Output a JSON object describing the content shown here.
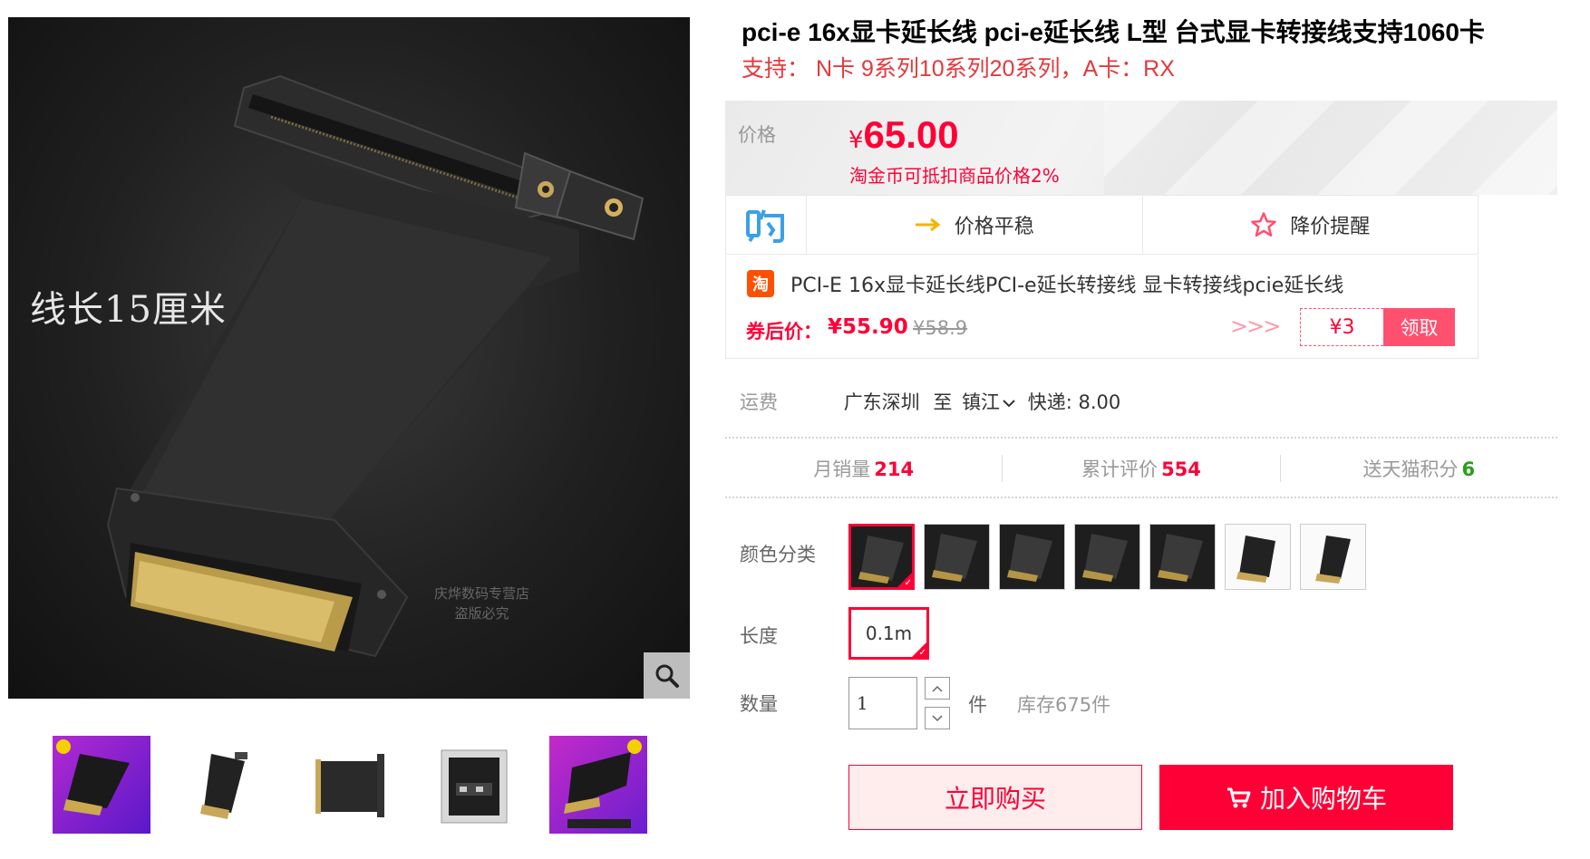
{
  "product": {
    "title": "pci-e 16x显卡延长线 pci-e延长线 L型 台式显卡转接线支持1060卡",
    "subtitle": "支持： N卡 9系列10系列20系列，A卡：RX"
  },
  "gallery": {
    "main_caption": "线长15厘米",
    "watermark_line1": "庆烨数码专营店",
    "watermark_line2": "盗版必究",
    "zoom_icon": "search-icon",
    "thumbnail_count": 5
  },
  "price": {
    "label": "价格",
    "currency": "¥",
    "value": "65.00",
    "note": "淘金币可抵扣商品价格2%"
  },
  "trend": {
    "logo_icon": "gou-logo-icon",
    "stable_label": "价格平稳",
    "alert_label": "降价提醒"
  },
  "coupon": {
    "logo_text": "淘",
    "title": "PCI-E 16x显卡延长线PCI-e延长转接线 显卡转接线pcie延长线",
    "after_label": "券后价：",
    "after_price": "¥55.90",
    "original_price": "¥58.9",
    "arrows": ">>>",
    "amount": "¥3",
    "claim_label": "领取"
  },
  "shipping": {
    "label": "运费",
    "from": "广东深圳",
    "to_word": "至",
    "to": "镇江",
    "method": "快递: 8.00"
  },
  "stats": {
    "monthly_sales_label": "月销量",
    "monthly_sales": "214",
    "reviews_label": "累计评价",
    "reviews": "554",
    "points_label": "送天猫积分",
    "points": "6"
  },
  "options": {
    "color_label": "颜色分类",
    "color_count": 7,
    "selected_color_index": 0,
    "length_label": "长度",
    "length_value": "0.1m",
    "quantity_label": "数量",
    "quantity_value": "1",
    "quantity_unit": "件",
    "stock": "库存675件"
  },
  "actions": {
    "buy_now": "立即购买",
    "add_to_cart": "加入购物车"
  },
  "colors": {
    "accent": "#ff0036",
    "coupon_pink": "#ff5070",
    "green": "#2a9d1f"
  }
}
